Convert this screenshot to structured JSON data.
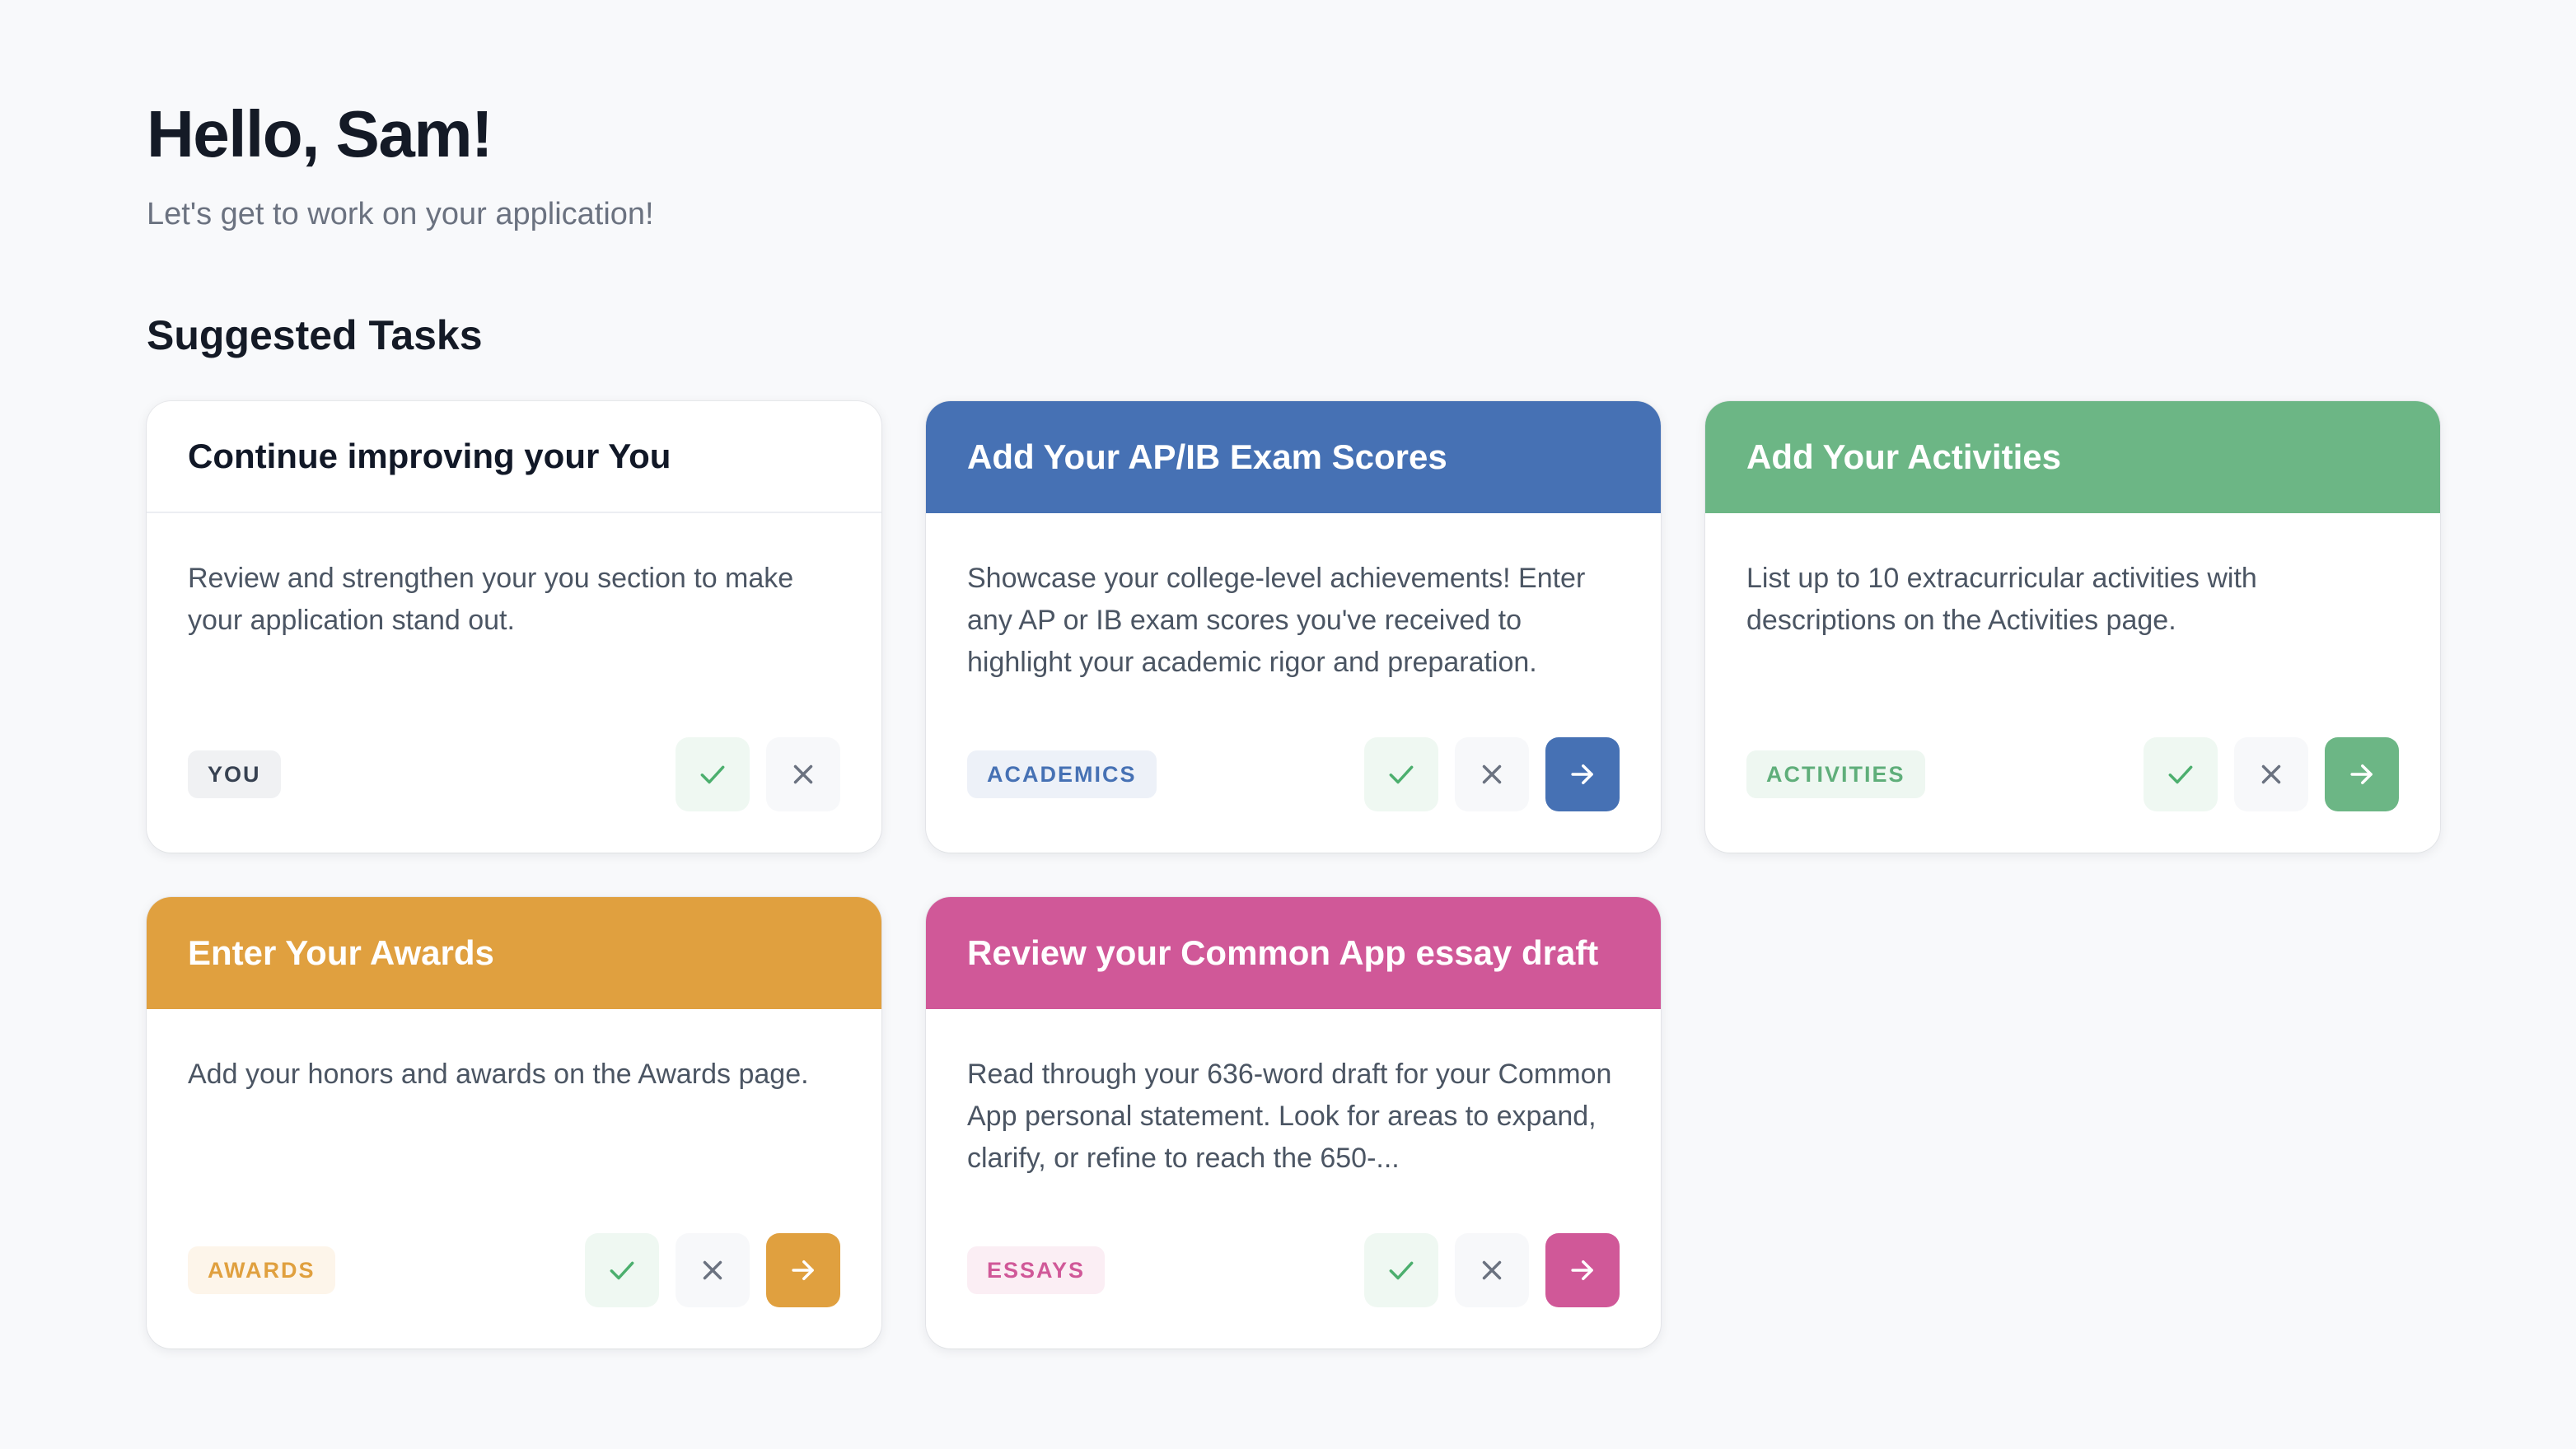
{
  "header": {
    "greeting": "Hello, Sam!",
    "subtitle": "Let's get to work on your application!"
  },
  "section": {
    "title": "Suggested Tasks"
  },
  "colors": {
    "blue": "#4671b4",
    "green": "#6cb685",
    "orange": "#e0a03f",
    "pink": "#d05898",
    "check": "#4caf6e",
    "dismiss": "#6b7280"
  },
  "icons": {
    "complete": "check-icon",
    "dismiss": "close-icon",
    "go": "arrow-right-icon"
  },
  "tasks": [
    {
      "title": "Continue improving your You",
      "description": "Review and strengthen your you section to make your application stand out.",
      "tag": "YOU",
      "theme": "plain"
    },
    {
      "title": "Add Your AP/IB Exam Scores",
      "description": "Showcase your college-level achievements! Enter any AP or IB exam scores you've received to highlight your academic rigor and preparation.",
      "tag": "ACADEMICS",
      "theme": "blue"
    },
    {
      "title": "Add Your Activities",
      "description": "List up to 10 extracurricular activities with descriptions on the Activities page.",
      "tag": "ACTIVITIES",
      "theme": "green"
    },
    {
      "title": "Enter Your Awards",
      "description": "Add your honors and awards on the Awards page.",
      "tag": "AWARDS",
      "theme": "orange"
    },
    {
      "title": "Review your Common App essay draft",
      "description": "Read through your 636-word draft for your Common App personal statement. Look for areas to expand, clarify, or refine to reach the 650-...",
      "tag": "ESSAYS",
      "theme": "pink"
    }
  ]
}
